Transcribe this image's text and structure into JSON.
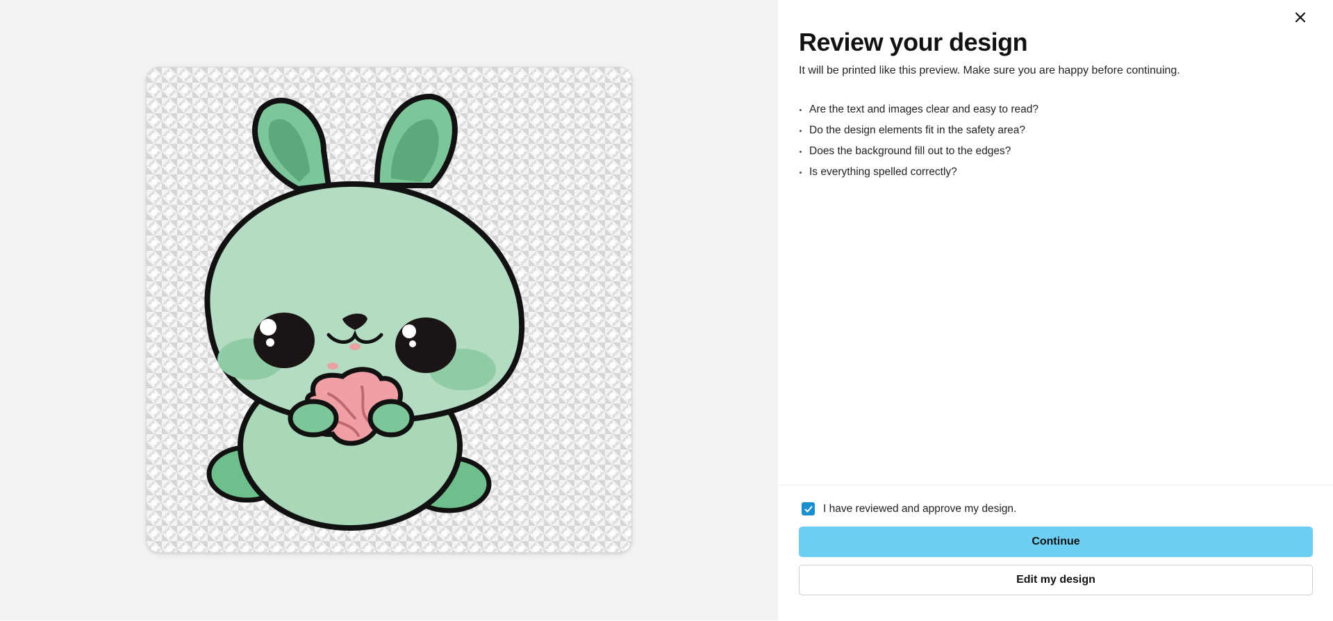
{
  "preview": {
    "image_alt": "Green bunny holding a pink brain sticker design"
  },
  "dialog": {
    "title": "Review your design",
    "subtitle": "It will be printed like this preview. Make sure you are happy before continuing.",
    "checklist": [
      "Are the text and images clear and easy to read?",
      "Do the design elements fit in the safety area?",
      "Does the background fill out to the edges?",
      "Is everything spelled correctly?"
    ],
    "close_icon": "close-icon"
  },
  "footer": {
    "approve_label": "I have reviewed and approve my design.",
    "approve_checked": true,
    "continue_label": "Continue",
    "edit_label": "Edit my design"
  },
  "colors": {
    "accent_button": "#6fcff3",
    "checkbox": "#1b8ed0",
    "left_background": "#f2f2f2"
  }
}
